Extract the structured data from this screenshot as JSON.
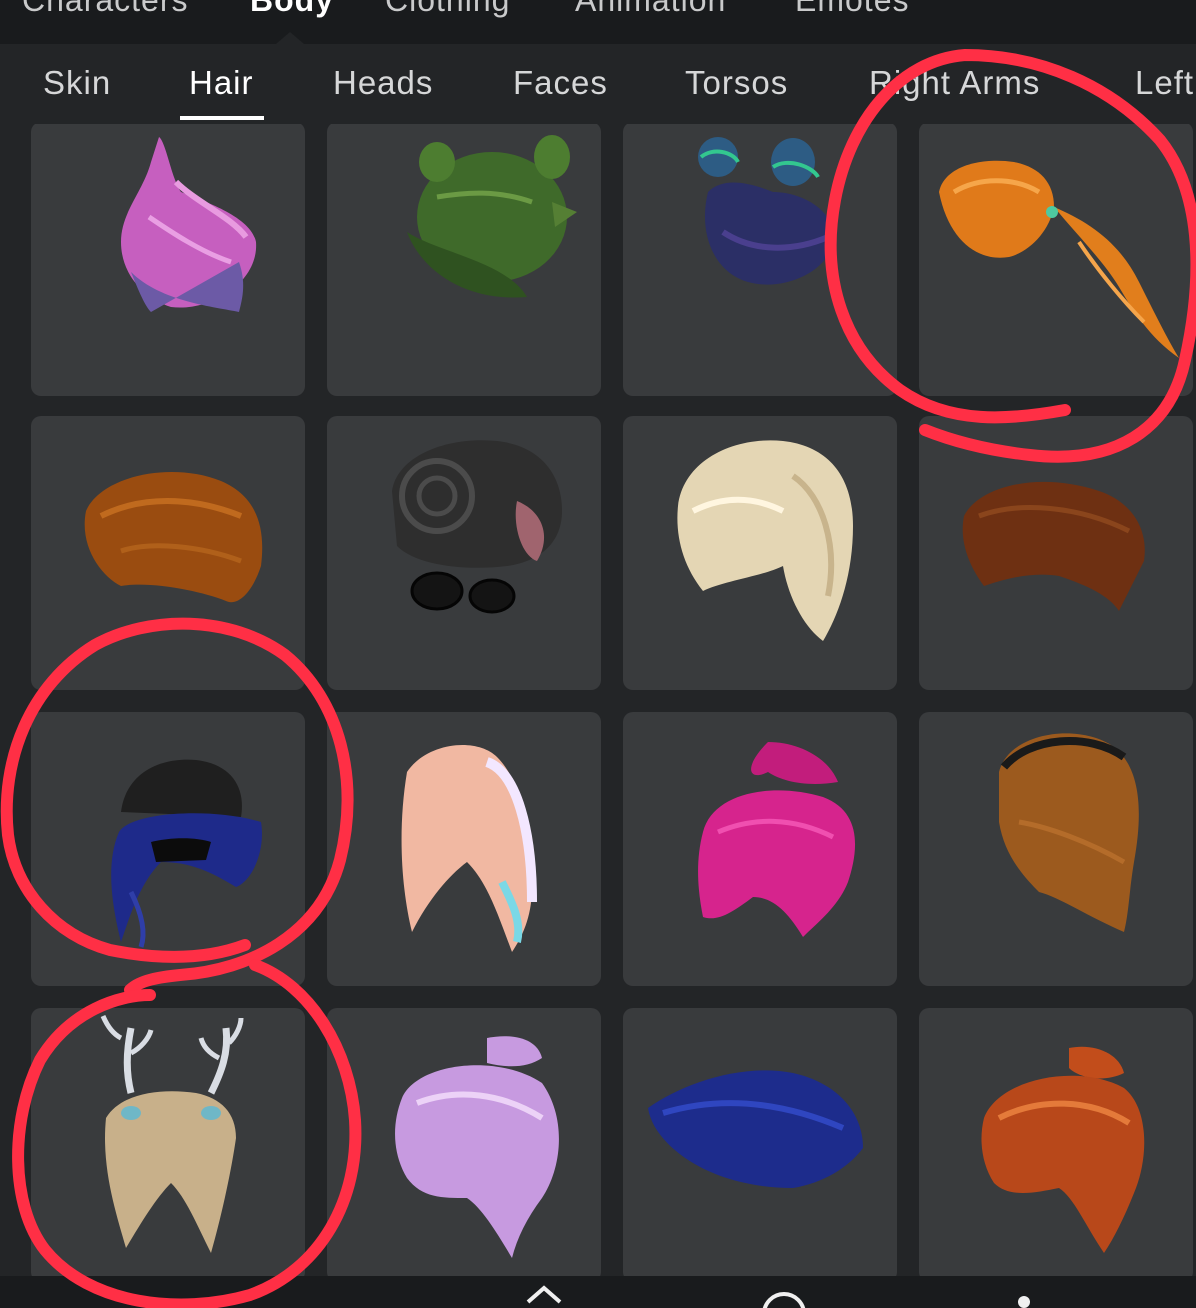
{
  "top_tabs": [
    "Characters",
    "Body",
    "Clothing",
    "Animation",
    "Emotes"
  ],
  "sub_tabs": [
    "Skin",
    "Hair",
    "Heads",
    "Faces",
    "Torsos",
    "Right Arms",
    "Left"
  ],
  "colors": {
    "background": "#232527",
    "tile": "#393b3d",
    "top_bar": "#191b1d",
    "annotation": "#ff2f45"
  },
  "hair_items": [
    {
      "icon": "pink-swept-hair-icon",
      "color": "#c65fbf"
    },
    {
      "icon": "green-bun-hair-icon",
      "color": "#3f6a2a"
    },
    {
      "icon": "navy-buns-hair-icon",
      "color": "#2b2f66"
    },
    {
      "icon": "orange-ponytail-hair-icon",
      "color": "#e07a1a"
    },
    {
      "icon": "brown-messy-hair-icon",
      "color": "#9a4c10"
    },
    {
      "icon": "black-swirl-hair-with-glasses-icon",
      "color": "#2e2e2e"
    },
    {
      "icon": "blonde-bob-hair-icon",
      "color": "#e4d6b4"
    },
    {
      "icon": "brown-spiky-hair-icon",
      "color": "#6e3012"
    },
    {
      "icon": "blue-hair-with-beanie-icon",
      "color": "#1e2a8a"
    },
    {
      "icon": "pastel-long-hair-icon",
      "color": "#f1b8a2"
    },
    {
      "icon": "magenta-fluffy-hair-icon",
      "color": "#d6248d"
    },
    {
      "icon": "brown-headband-hair-icon",
      "color": "#9c5a1e"
    },
    {
      "icon": "blonde-hair-with-antlers-icon",
      "color": "#c8b08a"
    },
    {
      "icon": "lavender-bun-hair-icon",
      "color": "#c79ae0"
    },
    {
      "icon": "blue-swept-hair-icon",
      "color": "#1d2c8c"
    },
    {
      "icon": "ginger-bun-hair-icon",
      "color": "#b8481a"
    }
  ],
  "bottom_nav": [
    "home-icon",
    "search-icon",
    "more-icon"
  ]
}
